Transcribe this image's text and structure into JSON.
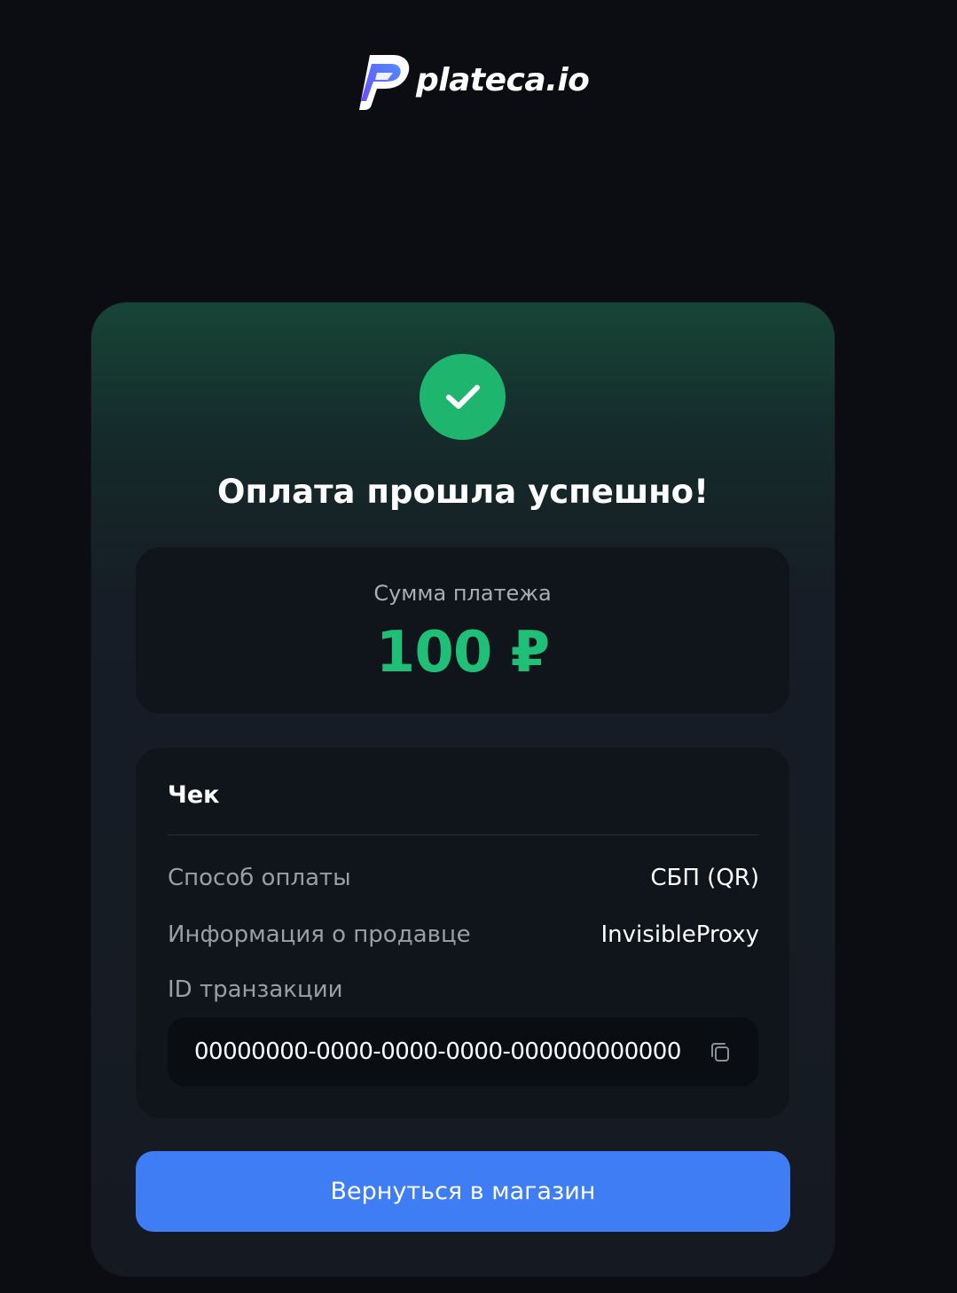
{
  "brand": {
    "name": "plateca.io",
    "logo_icon": "plateca-logo-icon"
  },
  "status": {
    "icon": "checkmark-icon",
    "title": "Оплата прошла успешно!"
  },
  "amount": {
    "label": "Сумма платежа",
    "value": "100 ₽"
  },
  "receipt": {
    "title": "Чек",
    "rows": [
      {
        "label": "Способ оплаты",
        "value": "СБП (QR)"
      },
      {
        "label": "Информация о продавце",
        "value": "InvisibleProxy"
      }
    ],
    "transaction": {
      "label": "ID транзакции",
      "id": "00000000-0000-0000-0000-000000000000",
      "copy_icon": "copy-icon"
    }
  },
  "actions": {
    "back_label": "Вернуться в магазин"
  },
  "colors": {
    "background": "#0b0d13",
    "success": "#1eb56f",
    "amount": "#1fbf78",
    "primary_button": "#3f7df4",
    "logo_gradient": [
      "#7b4dff",
      "#4f8cff"
    ]
  }
}
